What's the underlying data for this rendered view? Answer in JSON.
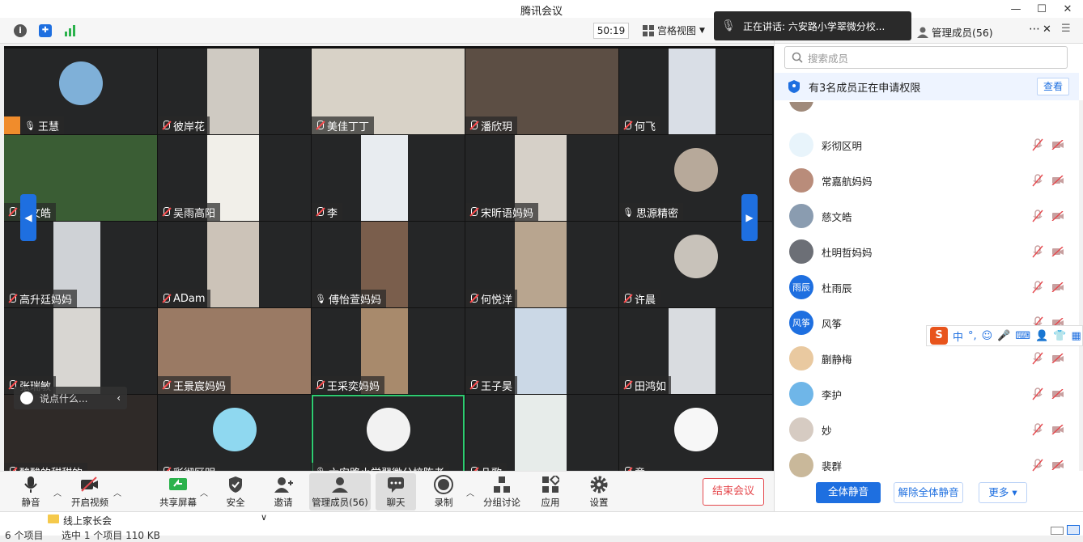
{
  "window": {
    "title": "腾讯会议"
  },
  "top": {
    "timer": "50:19",
    "view_label": "宫格视图"
  },
  "speaking": {
    "text": "正在讲话: 六安路小学翠微分校..."
  },
  "panel": {
    "title": "管理成员(56)",
    "search_placeholder": "搜索成员",
    "request_text": "有3名成员正在申请权限",
    "request_button": "查看",
    "members": [
      {
        "name": "彩彻区明",
        "avatar_text": "",
        "color": "#e8f4fb"
      },
      {
        "name": "常嘉航妈妈",
        "avatar_text": "",
        "color": "#b98c7a"
      },
      {
        "name": "慈文皓",
        "avatar_text": "",
        "color": "#8a9cb0"
      },
      {
        "name": "杜明哲妈妈",
        "avatar_text": "",
        "color": "#6c6f76"
      },
      {
        "name": "杜雨辰",
        "avatar_text": "雨辰",
        "color": "#1e6fe0"
      },
      {
        "name": "风筝",
        "avatar_text": "风筝",
        "color": "#1e6fe0"
      },
      {
        "name": "蒯静梅",
        "avatar_text": "",
        "color": "#e9c9a0"
      },
      {
        "name": "李护",
        "avatar_text": "",
        "color": "#6fb6e8"
      },
      {
        "name": "妙",
        "avatar_text": "",
        "color": "#d6cbc2"
      },
      {
        "name": "裴群",
        "avatar_text": "",
        "color": "#c9b89a"
      }
    ],
    "mute_all": "全体静音",
    "unmute_all": "解除全体静音",
    "more": "更多"
  },
  "tiles": [
    {
      "name": "王慧",
      "muted": false,
      "host": true
    },
    {
      "name": "彼岸花",
      "muted": true
    },
    {
      "name": "美佳丁丁",
      "muted": true
    },
    {
      "name": "潘欣玥",
      "muted": true
    },
    {
      "name": "何飞",
      "muted": true
    },
    {
      "name": "慈文皓",
      "muted": true
    },
    {
      "name": "吴雨高阳",
      "muted": true
    },
    {
      "name": "李",
      "muted": true
    },
    {
      "name": "宋昕语妈妈",
      "muted": true
    },
    {
      "name": "思源精密",
      "muted": false
    },
    {
      "name": "高升廷妈妈",
      "muted": true
    },
    {
      "name": "ADam",
      "muted": true
    },
    {
      "name": "傅怡萱妈妈",
      "muted": false
    },
    {
      "name": "何悦洋",
      "muted": true
    },
    {
      "name": "许晨",
      "muted": true
    },
    {
      "name": "张瑞敏",
      "muted": true
    },
    {
      "name": "王景宸妈妈",
      "muted": true
    },
    {
      "name": "王采奕妈妈",
      "muted": true
    },
    {
      "name": "王子昊",
      "muted": true
    },
    {
      "name": "田鸿如",
      "muted": true
    },
    {
      "name": "酸酸的甜甜的",
      "muted": true
    },
    {
      "name": "彩彻区明",
      "muted": true
    },
    {
      "name": "六安路小学翠微分校陈老",
      "muted": false,
      "speaking": true
    },
    {
      "name": "凡歌",
      "muted": true
    },
    {
      "name": "意",
      "muted": true
    }
  ],
  "chat_placeholder": "说点什么...",
  "toolbar": {
    "mute": "静音",
    "video": "开启视频",
    "share": "共享屏幕",
    "security": "安全",
    "invite": "邀请",
    "members": "管理成员(56)",
    "chat": "聊天",
    "record": "录制",
    "breakout": "分组讨论",
    "apps": "应用",
    "settings": "设置",
    "end": "结束会议"
  },
  "explorer": {
    "folder": "线上家长会",
    "status_left": "6 个项目",
    "status_mid": "选中 1 个项目  110 KB"
  },
  "ime": {
    "mode": "中"
  }
}
